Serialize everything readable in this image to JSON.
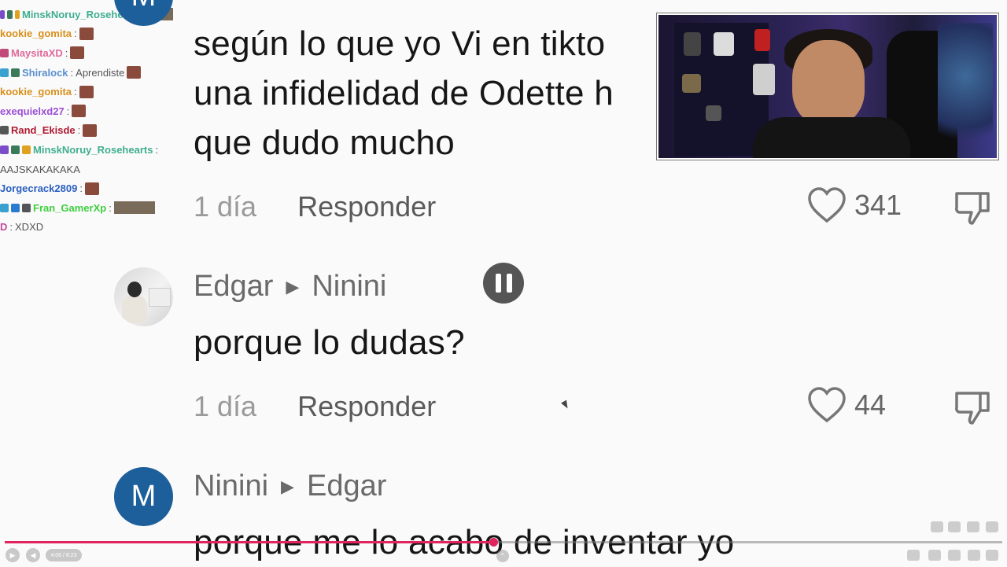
{
  "chat": [
    {
      "user": "MinskNoruy_Rosehearts",
      "color": "#3fae8f",
      "badges": [
        "#7b4cc7",
        "#3a7a5a",
        "#e0a020"
      ],
      "sep": " :",
      "message": "",
      "emote": "wide"
    },
    {
      "user": "kookie_gomita",
      "color": "#d9901c",
      "badges": [],
      "sep": " :",
      "message": "",
      "emote": "small"
    },
    {
      "user": "MaysitaXD",
      "color": "#e06a9a",
      "badges": [
        "#c04a7a"
      ],
      "sep": " :",
      "message": "",
      "emote": "small"
    },
    {
      "user": "Shiralock",
      "color": "#5a8fd0",
      "badges": [
        "#3aa0d0",
        "#3a7a5a"
      ],
      "sep": " :",
      "message": " Aprendiste",
      "emote": "small"
    },
    {
      "user": "kookie_gomita",
      "color": "#d9901c",
      "badges": [],
      "sep": " :",
      "message": "",
      "emote": "small"
    },
    {
      "user": "exequielxd27",
      "color": "#9b4ed6",
      "badges": [],
      "sep": " :",
      "message": "",
      "emote": "small"
    },
    {
      "user": "Rand_Ekisde",
      "color": "#b01a30",
      "badges": [
        "#555555"
      ],
      "sep": " :",
      "message": "",
      "emote": "small"
    },
    {
      "user": "MinskNoruy_Rosehearts",
      "color": "#3fae8f",
      "badges": [
        "#7b4cc7",
        "#3a7a5a",
        "#e0a020"
      ],
      "sep": " :",
      "message": "",
      "emote": "none"
    },
    {
      "user": "",
      "color": "#555555",
      "badges": [],
      "sep": "",
      "message": "AAJSKAKAKAKA",
      "emote": "none"
    },
    {
      "user": "Jorgecrack2809",
      "color": "#2b5fc0",
      "badges": [],
      "sep": " :",
      "message": "",
      "emote": "small"
    },
    {
      "user": "Fran_GamerXp",
      "color": "#3ecf3e",
      "badges": [
        "#3aa0d0",
        "#2a7ad0",
        "#555555"
      ],
      "sep": " :",
      "message": "",
      "emote": "wide"
    },
    {
      "user": "D",
      "color": "#c04a9a",
      "badges": [],
      "sep": " :",
      "message": " XDXD",
      "emote": "none"
    }
  ],
  "comments": [
    {
      "avatar_letter": "M",
      "text_lines": [
        "según lo que yo Vi en tikto",
        "una infidelidad de Odette h",
        "que dudo mucho"
      ],
      "date": "1 día",
      "reply_label": "Responder",
      "likes": "341"
    },
    {
      "author": "Edgar",
      "reply_to": "Ninini",
      "text_lines": [
        "porque lo dudas?"
      ],
      "date": "1 día",
      "reply_label": "Responder",
      "likes": "44"
    },
    {
      "avatar_letter": "M",
      "author": "Ninini",
      "reply_to": "Edgar",
      "text_lines": [
        "porque me lo acabo de inventar yo"
      ]
    }
  ],
  "player": {
    "time": "4:06 / 8:23",
    "progress": 0.49,
    "accent": "#e0245e"
  },
  "icons": {
    "heart": "heart-icon",
    "dislike": "thumbs-down-icon",
    "reply_arrow": "play-triangle-icon",
    "pause": "pause-icon"
  }
}
